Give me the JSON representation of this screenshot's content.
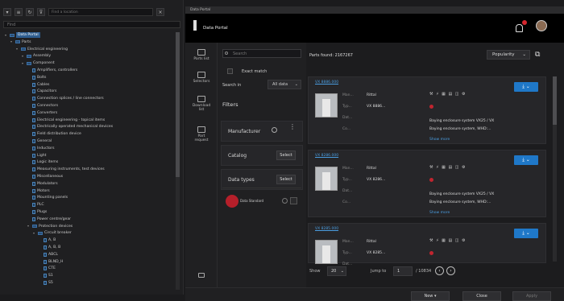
{
  "left_panel": {
    "toolbar_search_placeholder": "Find a location",
    "search_placeholder": "Find",
    "tree": [
      {
        "label": "Data Portal",
        "indent": 0,
        "kind": "folder",
        "selected": true
      },
      {
        "label": "Parts",
        "indent": 1,
        "kind": "folder"
      },
      {
        "label": "Electrical engineering",
        "indent": 2,
        "kind": "folder"
      },
      {
        "label": "Assembly",
        "indent": 3,
        "kind": "folder"
      },
      {
        "label": "Component",
        "indent": 3,
        "kind": "folder"
      },
      {
        "label": "Amplifiers, controllers",
        "indent": 4,
        "kind": "doc"
      },
      {
        "label": "Bolts",
        "indent": 4,
        "kind": "doc"
      },
      {
        "label": "Cables",
        "indent": 4,
        "kind": "doc"
      },
      {
        "label": "Capacitors",
        "indent": 4,
        "kind": "doc"
      },
      {
        "label": "Connection splices / line connectors",
        "indent": 4,
        "kind": "doc"
      },
      {
        "label": "Connectors",
        "indent": 4,
        "kind": "doc"
      },
      {
        "label": "Converters",
        "indent": 4,
        "kind": "doc"
      },
      {
        "label": "Electrical engineering - topical items",
        "indent": 4,
        "kind": "doc"
      },
      {
        "label": "Electrically operated mechanical devices",
        "indent": 4,
        "kind": "doc"
      },
      {
        "label": "Field distribution device",
        "indent": 4,
        "kind": "doc"
      },
      {
        "label": "General",
        "indent": 4,
        "kind": "doc"
      },
      {
        "label": "Inductors",
        "indent": 4,
        "kind": "doc"
      },
      {
        "label": "Light",
        "indent": 4,
        "kind": "doc"
      },
      {
        "label": "Logic items",
        "indent": 4,
        "kind": "doc"
      },
      {
        "label": "Measuring instruments, test devices",
        "indent": 4,
        "kind": "doc"
      },
      {
        "label": "Miscellaneous",
        "indent": 4,
        "kind": "doc"
      },
      {
        "label": "Modulators",
        "indent": 4,
        "kind": "doc"
      },
      {
        "label": "Motors",
        "indent": 4,
        "kind": "doc"
      },
      {
        "label": "Mounting panels",
        "indent": 4,
        "kind": "doc"
      },
      {
        "label": "PLC",
        "indent": 4,
        "kind": "doc"
      },
      {
        "label": "Plugs",
        "indent": 4,
        "kind": "doc"
      },
      {
        "label": "Power centre/gear",
        "indent": 4,
        "kind": "doc"
      },
      {
        "label": "Protection devices",
        "indent": 4,
        "kind": "folder"
      },
      {
        "label": "Circuit breaker",
        "indent": 5,
        "kind": "folder"
      },
      {
        "label": "A, B",
        "indent": 6,
        "kind": "doc"
      },
      {
        "label": "A, B, B",
        "indent": 6,
        "kind": "doc"
      },
      {
        "label": "ABCL",
        "indent": 6,
        "kind": "doc"
      },
      {
        "label": "BLND_H",
        "indent": 6,
        "kind": "doc"
      },
      {
        "label": "CTE",
        "indent": 6,
        "kind": "doc"
      },
      {
        "label": "S1",
        "indent": 6,
        "kind": "doc"
      },
      {
        "label": "S5",
        "indent": 6,
        "kind": "doc"
      }
    ]
  },
  "window": {
    "title": "Data Portal",
    "header_title": "Data Portal",
    "nav": [
      {
        "label": "Parts list",
        "icon": "list-icon"
      },
      {
        "label": "Selectors",
        "icon": "selector-icon"
      },
      {
        "label": "Download list",
        "icon": "download-icon"
      },
      {
        "label": "Part request",
        "icon": "request-icon"
      }
    ],
    "filters": {
      "search_placeholder": "Search",
      "exact_match_label": "Exact match",
      "search_in_label": "Search in",
      "search_in_value": "All data",
      "heading": "Filters",
      "manufacturer_label": "Manufacturer",
      "catalog_label": "Catalog",
      "catalog_button": "Select",
      "datatypes_label": "Data types",
      "datatypes_button": "Select",
      "cad_label": "Data Standard"
    },
    "results": {
      "found_text": "Parts found: 2167267",
      "sort_value": "Popularity",
      "cards": [
        {
          "link": "VX 8886.000",
          "keys": [
            "Man...",
            "Typ...",
            "Dat...",
            "Co..."
          ],
          "vals": [
            "Rittal",
            "VX 8886...",
            "",
            ""
          ],
          "icons": "⚒ ⚡ ▦ ▤ ◫ ⚙",
          "desc1": "Baying enclosure system VX25 / VX",
          "desc2": "Baying enclosure system, WHD:...",
          "more": "Show more"
        },
        {
          "link": "VX 8286.000",
          "keys": [
            "Man...",
            "Typ...",
            "Dat...",
            "Co..."
          ],
          "vals": [
            "Rittal",
            "VX 8286...",
            "",
            ""
          ],
          "icons": "⚒ ⚡ ▦ ▤ ◫ ⚙",
          "desc1": "Baying enclosure system VX25 / VX",
          "desc2": "Baying enclosure system, WHD:...",
          "more": "Show more"
        },
        {
          "link": "VX 8285.000",
          "keys": [
            "Man...",
            "Typ...",
            "Dat..."
          ],
          "vals": [
            "Rittal",
            "VX 8285...",
            ""
          ],
          "icons": "⚒ ⚡ ▦ ▤ ◫ ⚙",
          "desc1": "",
          "desc2": "",
          "more": ""
        }
      ],
      "pager": {
        "show_label": "Show",
        "show_value": "20",
        "jump_label": "Jump to",
        "jump_value": "1",
        "total_text": "/ 10834"
      }
    },
    "bottom_buttons": {
      "new": "New",
      "close": "Close",
      "apply": "Apply"
    }
  }
}
